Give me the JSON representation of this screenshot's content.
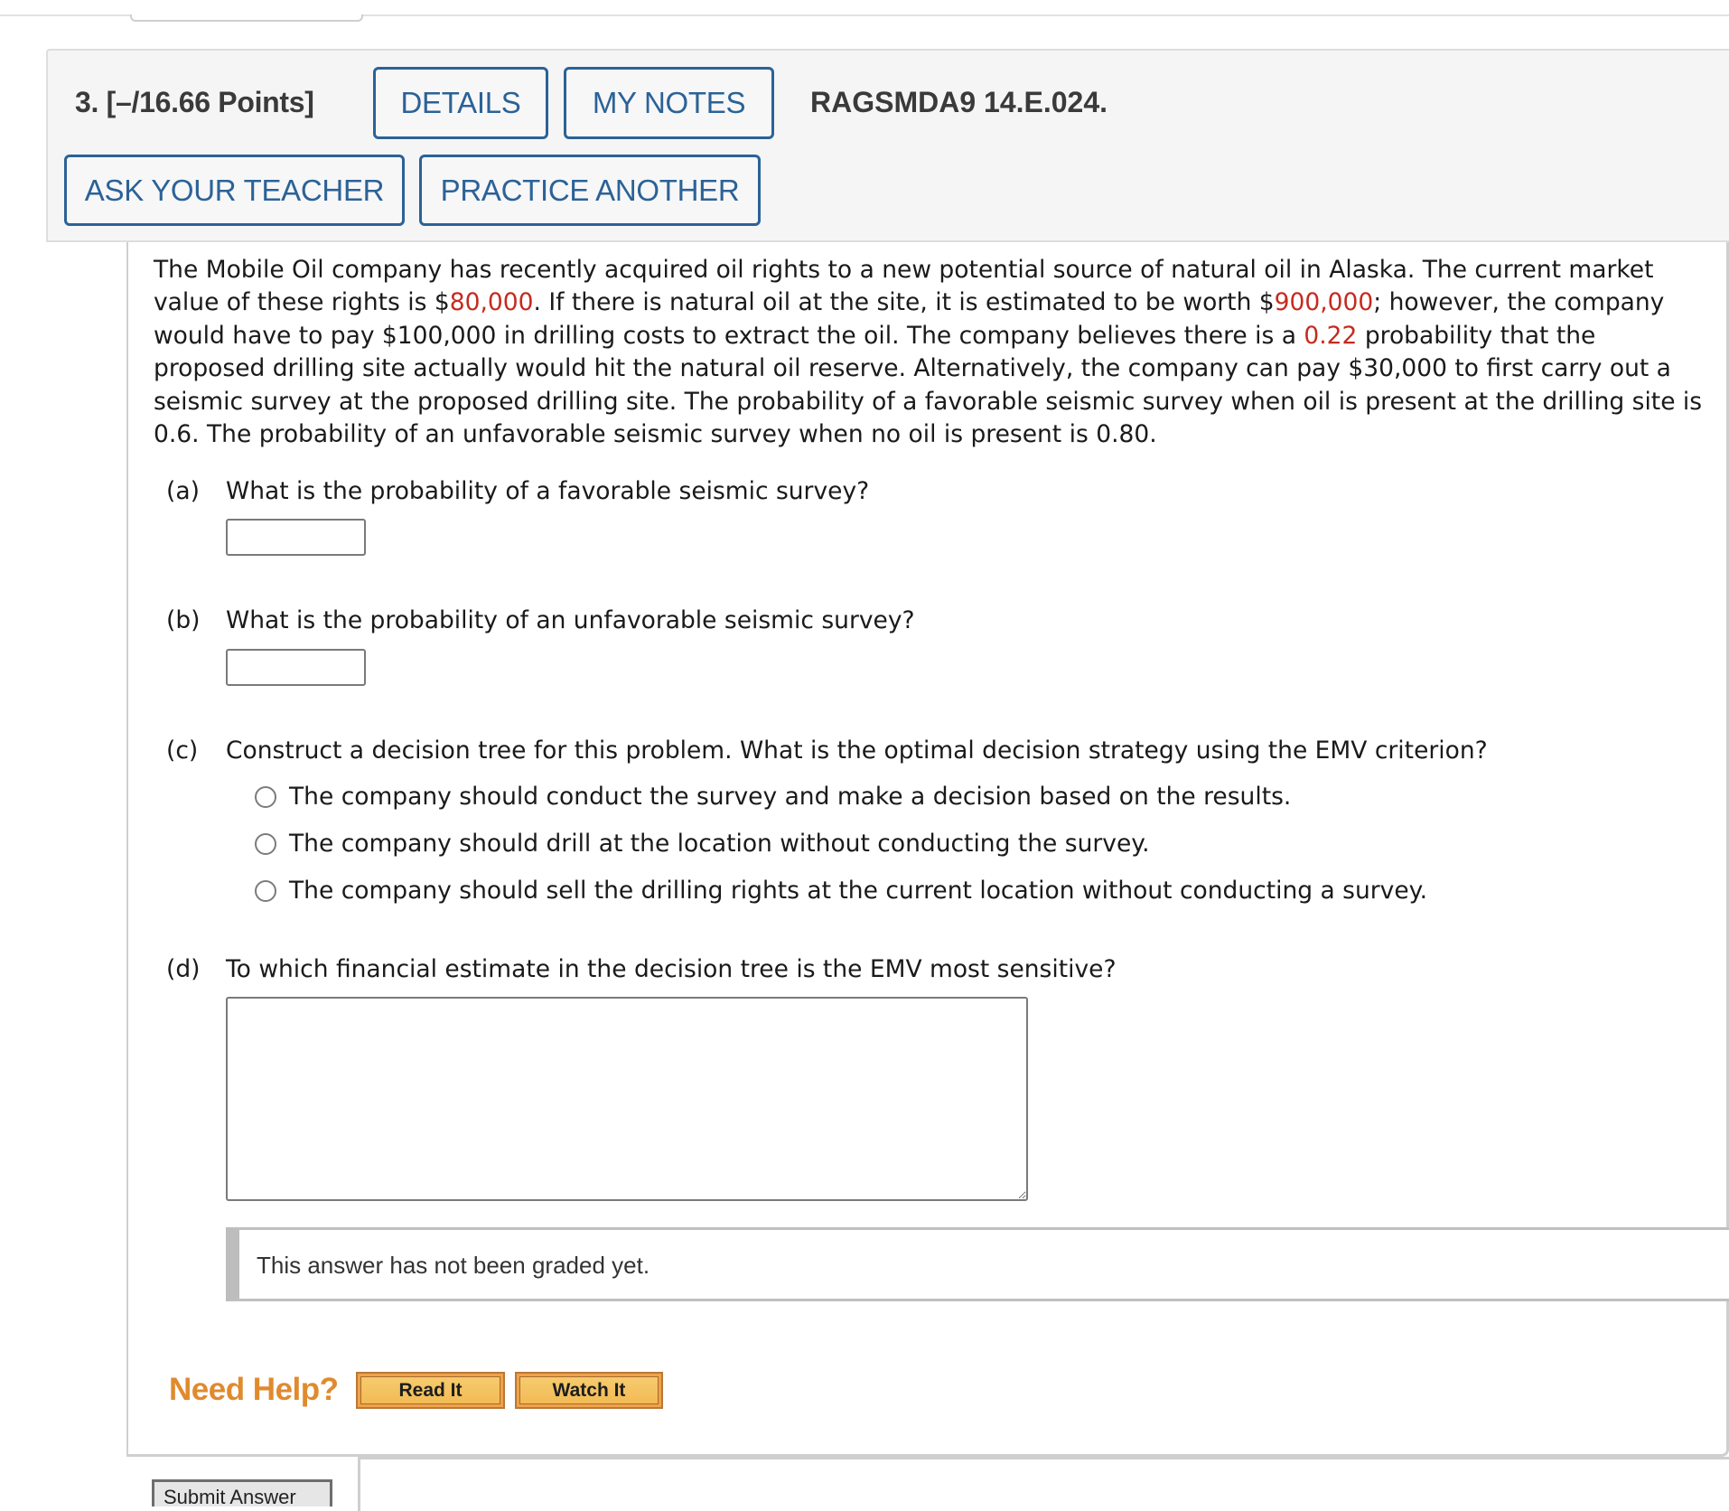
{
  "question": {
    "number_points": "3.  [–/16.66 Points]",
    "code": "RAGSMDA9 14.E.024.",
    "buttons": {
      "details": "DETAILS",
      "my_notes": "MY NOTES",
      "ask_teacher": "ASK YOUR TEACHER",
      "practice_another": "PRACTICE ANOTHER"
    }
  },
  "problem": {
    "p1": "The Mobile Oil company has recently acquired oil rights to a new potential source of natural oil in Alaska. The current market value of these rights is $",
    "market_value": "80,000",
    "p2": ". If there is natural oil at the site, it is estimated to be worth $",
    "oil_worth": "900,000",
    "p3": "; however, the company would have to pay $100,000 in drilling costs to extract the oil. The company believes there is a ",
    "probability": "0.22",
    "p4": " probability that the proposed drilling site actually would hit the natural oil reserve. Alternatively, the company can pay $30,000 to first carry out a seismic survey at the proposed drilling site. The probability of a favorable seismic survey when oil is present at the drilling site is 0.6. The probability of an unfavorable seismic survey when no oil is present is 0.80.",
    "highlight_color": "#c62a1f"
  },
  "parts": {
    "a": {
      "label": "(a)",
      "text": "What is the probability of a favorable seismic survey?",
      "value": ""
    },
    "b": {
      "label": "(b)",
      "text": "What is the probability of an unfavorable seismic survey?",
      "value": ""
    },
    "c": {
      "label": "(c)",
      "text": "Construct a decision tree for this problem. What is the optimal decision strategy using the EMV criterion?",
      "options": [
        "The company should conduct the survey and make a decision based on the results.",
        "The company should drill at the location without conducting the survey.",
        "The company should sell the drilling rights at the current location without conducting a survey."
      ]
    },
    "d": {
      "label": "(d)",
      "text": "To which financial estimate in the decision tree is the EMV most sensitive?",
      "value": ""
    }
  },
  "grading": {
    "status": "This answer has not been graded yet."
  },
  "help": {
    "label": "Need Help?",
    "read_it": "Read It",
    "watch_it": "Watch It"
  },
  "submit": {
    "label": "Submit Answer"
  },
  "colors": {
    "accent_blue": "#2b6297",
    "help_orange": "#e08a2e"
  }
}
